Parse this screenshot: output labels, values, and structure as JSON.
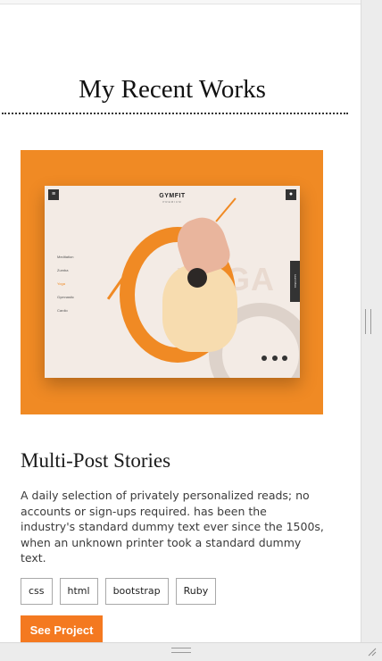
{
  "section": {
    "title": "My Recent Works"
  },
  "project": {
    "title": "Multi-Post Stories",
    "description": "A daily selection of privately personalized reads; no accounts or sign-ups required. has been the industry's standard dummy text ever since the 1500s, when an unknown printer took a standard dummy text.",
    "tags": [
      "css",
      "html",
      "bootstrap",
      "Ruby"
    ],
    "cta_label": "See Project",
    "thumbnail": {
      "brand": "GYMFIT",
      "brand_sub": "PREMIUM",
      "watermark": "YOGA",
      "menu": [
        "Meditation",
        "Zumba",
        "Yoga",
        "Gymnastic",
        "Cardio"
      ],
      "side_button": "Learn More"
    }
  },
  "colors": {
    "accent": "#f47920",
    "thumbnail_bg": "#f08a24",
    "text": "#3b3b3b"
  },
  "icons": [
    "menu-icon",
    "user-icon",
    "resize-grip-icon"
  ]
}
